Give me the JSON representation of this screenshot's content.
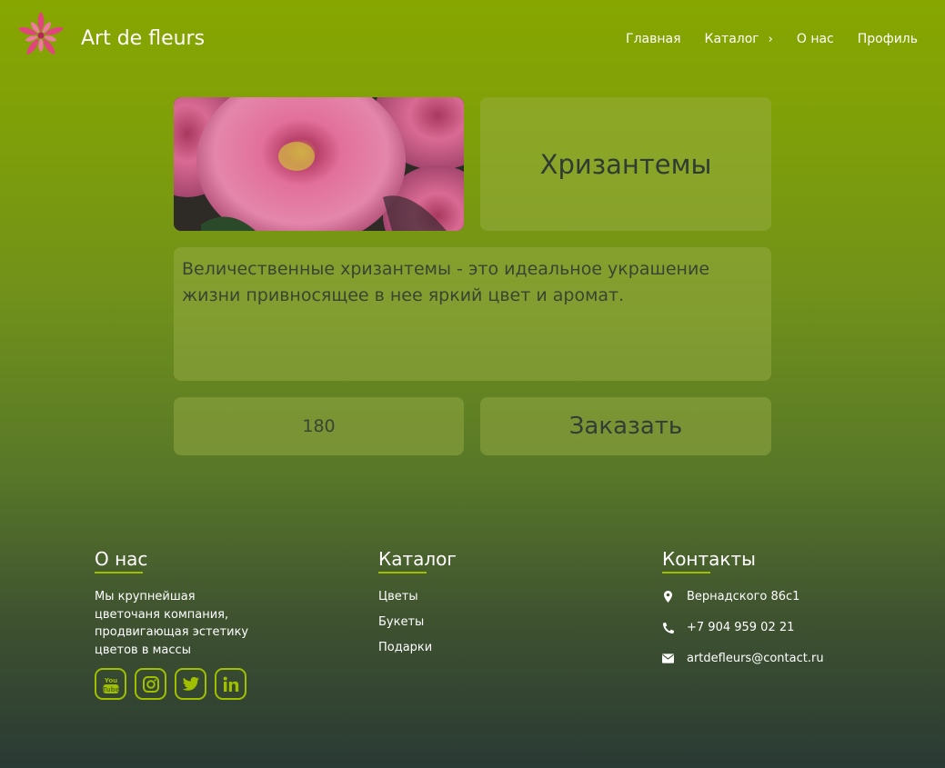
{
  "header": {
    "brand": "Art de fleurs",
    "nav": [
      {
        "label": "Главная"
      },
      {
        "label": "Каталог",
        "icon": "chevron-right-icon"
      },
      {
        "label": "О нас"
      },
      {
        "label": "Профиль"
      }
    ]
  },
  "product": {
    "title": "Хризантемы",
    "description": "Величественные хризантемы - это идеальное украшение жизни привносящее в нее яркий цвет и аромат.",
    "price": "180",
    "order_label": "Заказать"
  },
  "footer": {
    "about": {
      "heading": "О нас",
      "text": "Мы крупнейшая цветочаня компания, продвигающая эстетику цветов в массы",
      "social": [
        "youtube-icon",
        "instagram-icon",
        "twitter-icon",
        "linkedin-icon"
      ]
    },
    "catalog": {
      "heading": "Каталог",
      "links": [
        "Цветы",
        "Букеты",
        "Подарки"
      ]
    },
    "contacts": {
      "heading": "Контакты",
      "address": "Вернадского 86с1",
      "phone": "+7 904 959 02 21",
      "email": "artdefleurs@contact.ru"
    }
  },
  "colors": {
    "accent": "#9fbf00",
    "logo": "#e0457b",
    "tile": "#9cb04a"
  }
}
